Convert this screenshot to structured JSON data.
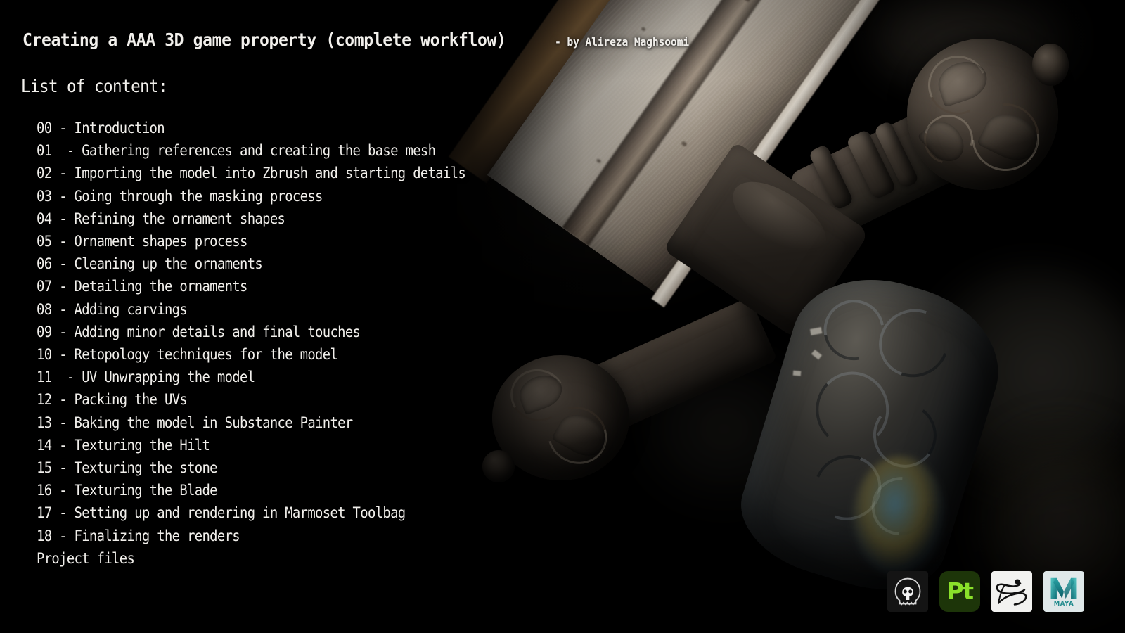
{
  "title": {
    "main": "Creating a AAA 3D game property (complete workflow)",
    "byline": "- by Alireza Maghsoomi"
  },
  "list_heading": "List of content:",
  "toc": [
    "00 - Introduction",
    "01  - Gathering references and creating the base mesh",
    "02 - Importing the model into Zbrush and starting details",
    "03 - Going through the masking process",
    "04 - Refining the ornament shapes",
    "05 - Ornament shapes process",
    "06 - Cleaning up the ornaments",
    "07 - Detailing the ornaments",
    "08 - Adding carvings",
    "09 - Adding minor details and final touches",
    "10 - Retopology techniques for the model",
    "11  - UV Unwrapping the model",
    "12 - Packing the UVs",
    "13 - Baking the model in Substance Painter",
    "14 - Texturing the Hilt",
    "15 - Texturing the stone",
    "16 - Texturing the Blade",
    "17 - Setting up and rendering in Marmoset Toolbag",
    "18 - Finalizing the renders",
    "Project files"
  ],
  "logos": [
    {
      "name": "marmoset-toolbag-logo",
      "icon": "skull-icon",
      "label": ""
    },
    {
      "name": "substance-painter-logo",
      "icon": "pt-icon",
      "label": "Pt"
    },
    {
      "name": "zbrush-logo",
      "icon": "brush-stroke-icon",
      "label": ""
    },
    {
      "name": "maya-logo",
      "icon": "maya-m-icon",
      "label": "MAYA"
    }
  ],
  "colors": {
    "background": "#000000",
    "text": "#f1efeb",
    "painter_green": "#8ae02a",
    "painter_bg": "#1d3509",
    "maya_teal": "#1f8a8c",
    "maya_bg": "#dfe8e9",
    "zbrush_bg": "#f2f2f0",
    "toolbag_bg": "#141414"
  }
}
